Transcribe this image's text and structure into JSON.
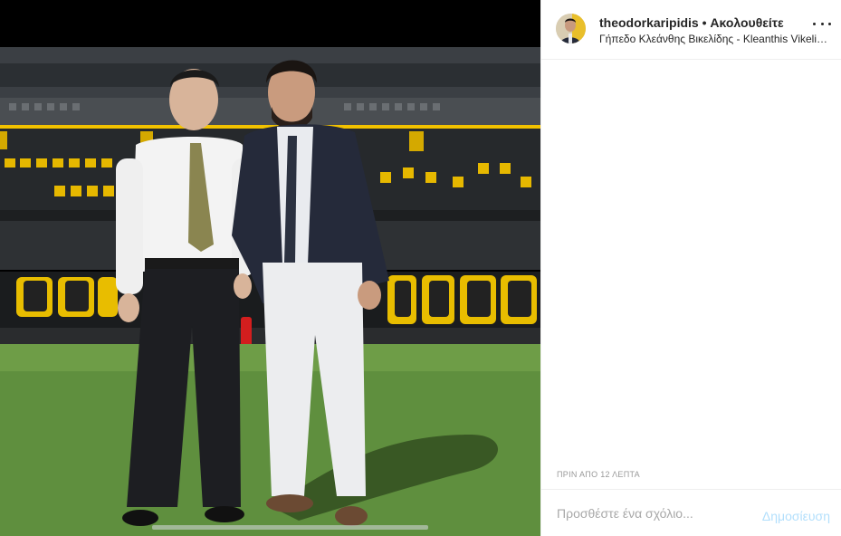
{
  "post": {
    "username": "theodorkaripidis",
    "separator": "•",
    "follow_state": "Ακολουθείτε",
    "location": "Γήπεδο Κλεάνθης Βικελίδης - Kleanthis Vikelidis Stadium",
    "timestamp": "ΠΡΙΝ ΑΠΟ 12 ΛΕΠΤΑ"
  },
  "comment": {
    "placeholder": "Προσθέστε ένα σχόλιο...",
    "publish_label": "Δημοσίευση"
  },
  "icons": {
    "more": "more-options-icon"
  },
  "colors": {
    "text": "#262626",
    "muted": "#999999",
    "publish_disabled": "#b2dffc",
    "stadium_yellow": "#f2c200"
  }
}
